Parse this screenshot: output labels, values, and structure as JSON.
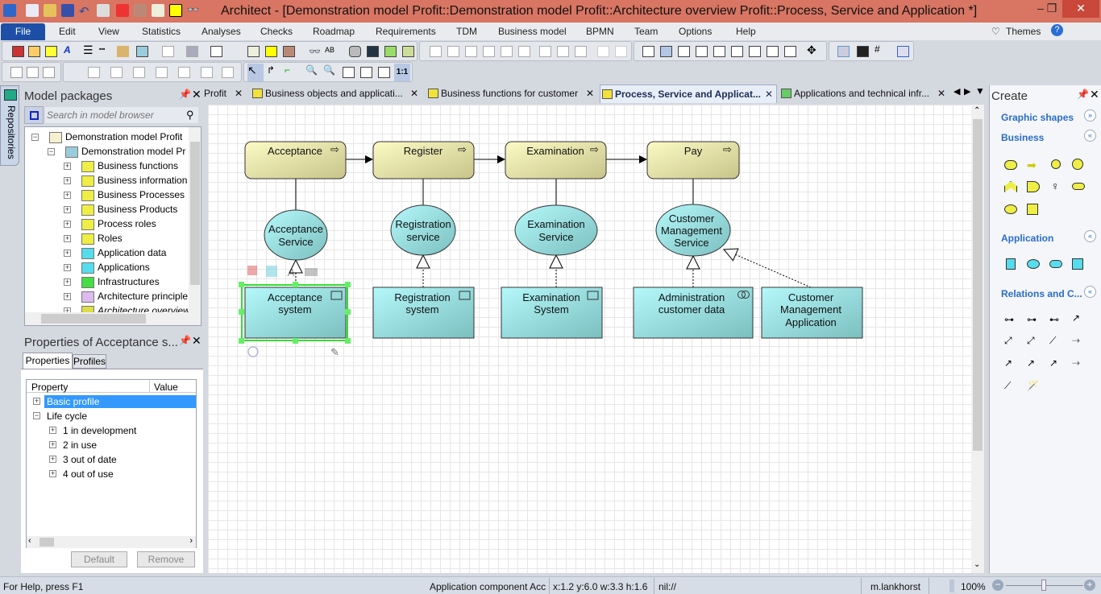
{
  "window": {
    "title": "Architect - [Demonstration model Profit::Demonstration model Profit::Architecture overview Profit::Process, Service and Application *]",
    "minimize": "‒",
    "restore": "❐",
    "close": "✕"
  },
  "menu": {
    "file": "File",
    "items": [
      "Edit",
      "View",
      "Statistics",
      "Analyses",
      "Checks",
      "Roadmap",
      "Requirements",
      "TDM",
      "Business model",
      "BPMN",
      "Team",
      "Options",
      "Help"
    ],
    "themes": "Themes"
  },
  "tabs": [
    {
      "label": "Profit",
      "close": "✕"
    },
    {
      "label": "Business objects and applicati...",
      "close": "✕"
    },
    {
      "label": "Business functions for customer",
      "close": "✕"
    },
    {
      "label": "Process, Service and Applicat...",
      "close": "✕",
      "active": true
    },
    {
      "label": "Applications and technical infr...",
      "close": "✕"
    }
  ],
  "sidebar": {
    "repositories": "Repositories"
  },
  "model_packages": {
    "title": "Model packages",
    "search_placeholder": "Search in model browser",
    "tree": [
      {
        "label": "Demonstration model Profit",
        "level": 0
      },
      {
        "label": "Demonstration model Pr",
        "level": 1
      },
      {
        "label": "Business functions",
        "level": 2,
        "icon": "business-folder-icon"
      },
      {
        "label": "Business information",
        "level": 2,
        "icon": "business-folder-icon"
      },
      {
        "label": "Business Processes",
        "level": 2,
        "icon": "business-folder-icon"
      },
      {
        "label": "Business Products",
        "level": 2,
        "icon": "business-folder-icon"
      },
      {
        "label": "Process roles",
        "level": 2,
        "icon": "business-folder-icon"
      },
      {
        "label": "Roles",
        "level": 2,
        "icon": "business-folder-icon"
      },
      {
        "label": "Application data",
        "level": 2,
        "icon": "application-folder-icon"
      },
      {
        "label": "Applications",
        "level": 2,
        "icon": "application-folder-icon"
      },
      {
        "label": "Infrastructures",
        "level": 2,
        "icon": "infrastructure-folder-icon"
      },
      {
        "label": "Architecture principle",
        "level": 2,
        "icon": "principle-folder-icon"
      },
      {
        "label": "Architecture overview",
        "level": 2,
        "icon": "view-folder-icon"
      }
    ]
  },
  "properties": {
    "title": "Properties of Acceptance s...",
    "tabs": [
      "Properties",
      "Profiles"
    ],
    "columns": [
      "Property",
      "Value"
    ],
    "rows": [
      {
        "label": "Basic profile",
        "level": 0,
        "selected": true
      },
      {
        "label": "Life cycle",
        "level": 0
      },
      {
        "label": "1 in development",
        "level": 1
      },
      {
        "label": "2 in use",
        "level": 1
      },
      {
        "label": "3 out of date",
        "level": 1
      },
      {
        "label": "4 out of use",
        "level": 1
      }
    ],
    "default_button": "Default",
    "remove_button": "Remove"
  },
  "diagram": {
    "processes": [
      "Acceptance",
      "Register",
      "Examination",
      "Pay"
    ],
    "services": [
      [
        "Acceptance",
        "Service"
      ],
      [
        "Registration",
        "service"
      ],
      [
        "Examination",
        "Service"
      ],
      [
        "Customer",
        "Management",
        "Service"
      ]
    ],
    "components": [
      [
        "Acceptance",
        "system"
      ],
      [
        "Registration",
        "system"
      ],
      [
        "Examination",
        "System"
      ],
      [
        "Administration",
        "customer data"
      ],
      [
        "Customer",
        "Management",
        "Application"
      ]
    ],
    "selected": "Acceptance system",
    "colors": {
      "process": "#f0eeaa",
      "application": "#a8ecee",
      "selection": "#33dd33"
    }
  },
  "create": {
    "title": "Create",
    "sections": [
      "Graphic shapes",
      "Business",
      "Application",
      "Relations and C..."
    ]
  },
  "status": {
    "help": "For Help, press F1",
    "element": "Application component Acc",
    "geometry": "x:1.2 y:6.0 w:3.3 h:1.6",
    "path": "nil://",
    "user": "m.lankhorst",
    "zoom": "100%",
    "zoom_level": 100
  }
}
